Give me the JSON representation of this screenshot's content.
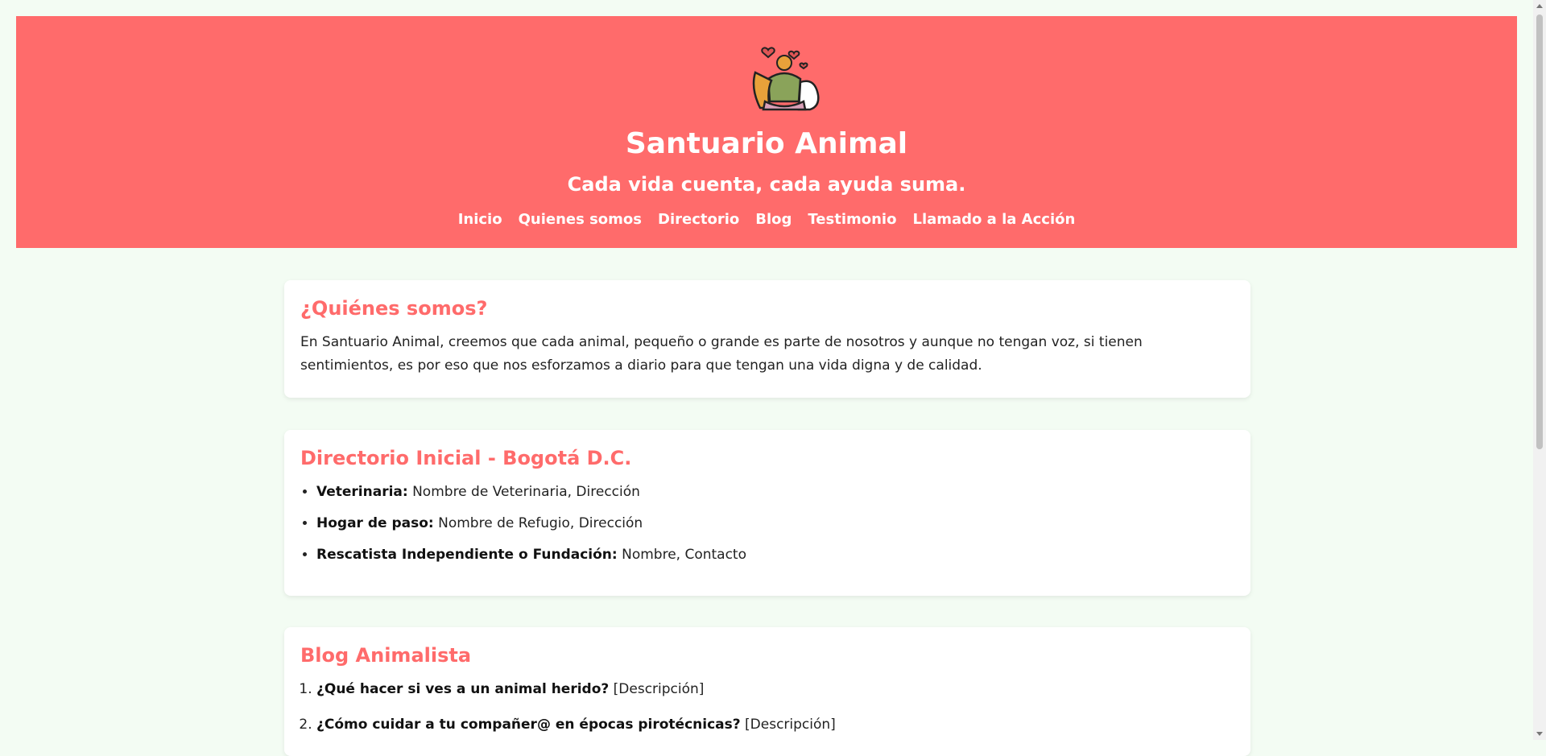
{
  "header": {
    "logo_icon": "person-with-pets-hearts-icon",
    "title": "Santuario Animal",
    "tagline": "Cada vida cuenta, cada ayuda suma.",
    "nav": [
      "Inicio",
      "Quienes somos",
      "Directorio",
      "Blog",
      "Testimonio",
      "Llamado a la Acción"
    ]
  },
  "about": {
    "heading": "¿Quiénes somos?",
    "text": "En Santuario Animal, creemos que cada animal, pequeño o grande es parte de nosotros y aunque no tengan voz, si tienen sentimientos, es por eso que nos esforzamos a diario para que tengan una vida digna y de calidad."
  },
  "directory": {
    "heading": "Directorio Inicial - Bogotá D.C.",
    "items": [
      {
        "label": "Veterinaria:",
        "value": "Nombre de Veterinaria, Dirección"
      },
      {
        "label": "Hogar de paso:",
        "value": "Nombre de Refugio, Dirección"
      },
      {
        "label": "Rescatista Independiente o Fundación:",
        "value": "Nombre, Contacto"
      }
    ]
  },
  "blog": {
    "heading": "Blog Animalista",
    "items": [
      {
        "label": "¿Qué hacer si ves a un animal herido?",
        "value": "[Descripción]"
      },
      {
        "label": "¿Cómo cuidar a tu compañer@ en épocas pirotécnicas?",
        "value": "[Descripción]"
      }
    ]
  },
  "colors": {
    "accent": "#ff6b6b",
    "background": "#f3fcf3"
  }
}
